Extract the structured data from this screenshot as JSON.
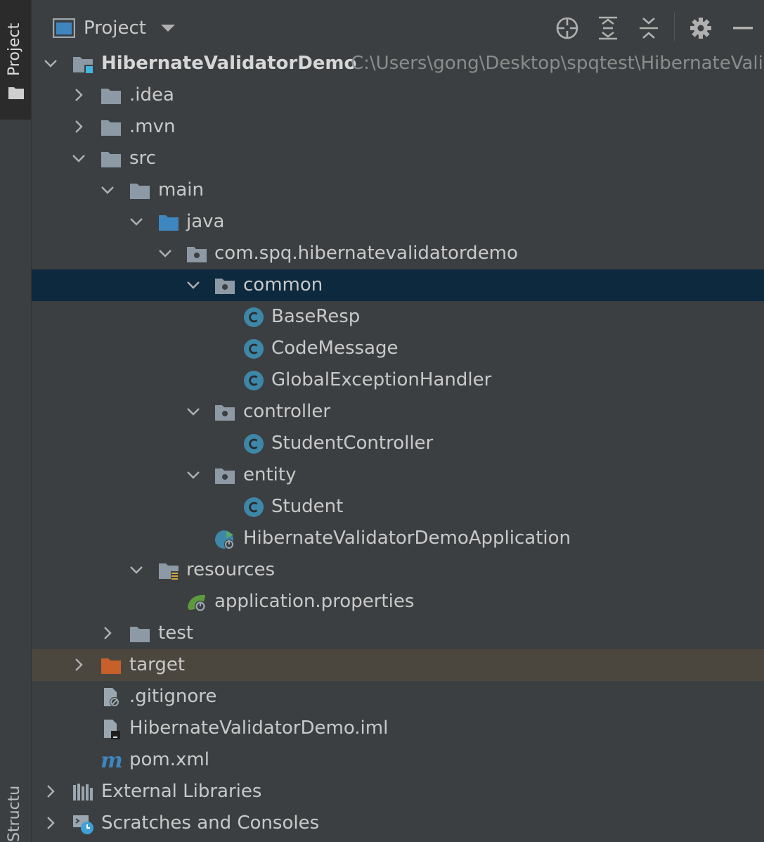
{
  "sidebar": {
    "tab_label": "Project",
    "bottom_label": "Structure"
  },
  "header": {
    "title": "Project"
  },
  "tree": {
    "root": {
      "label": "HibernateValidatorDemo",
      "path": "C:\\Users\\gong\\Desktop\\spqtest\\HibernateValidatorDemo"
    },
    "idea": ".idea",
    "mvn": ".mvn",
    "src": "src",
    "main": "main",
    "java": "java",
    "package": "com.spq.hibernatevalidatordemo",
    "common": "common",
    "base_resp": "BaseResp",
    "code_message": "CodeMessage",
    "global_handler": "GlobalExceptionHandler",
    "controller": "controller",
    "student_controller": "StudentController",
    "entity": "entity",
    "student": "Student",
    "app_class": "HibernateValidatorDemoApplication",
    "resources": "resources",
    "app_props": "application.properties",
    "test": "test",
    "target": "target",
    "gitignore": ".gitignore",
    "iml": "HibernateValidatorDemo.iml",
    "pom": "pom.xml",
    "external_libs": "External Libraries",
    "scratches": "Scratches and Consoles"
  },
  "colors": {
    "background": "#3c3f41",
    "selection": "#0d293e",
    "excluded_row": "#4b473f",
    "folder": "#8d99a5",
    "source_folder": "#3e86c0",
    "excluded_folder": "#c7602a",
    "class_icon": "#3d87a8",
    "spring_green": "#5e9a3d"
  }
}
